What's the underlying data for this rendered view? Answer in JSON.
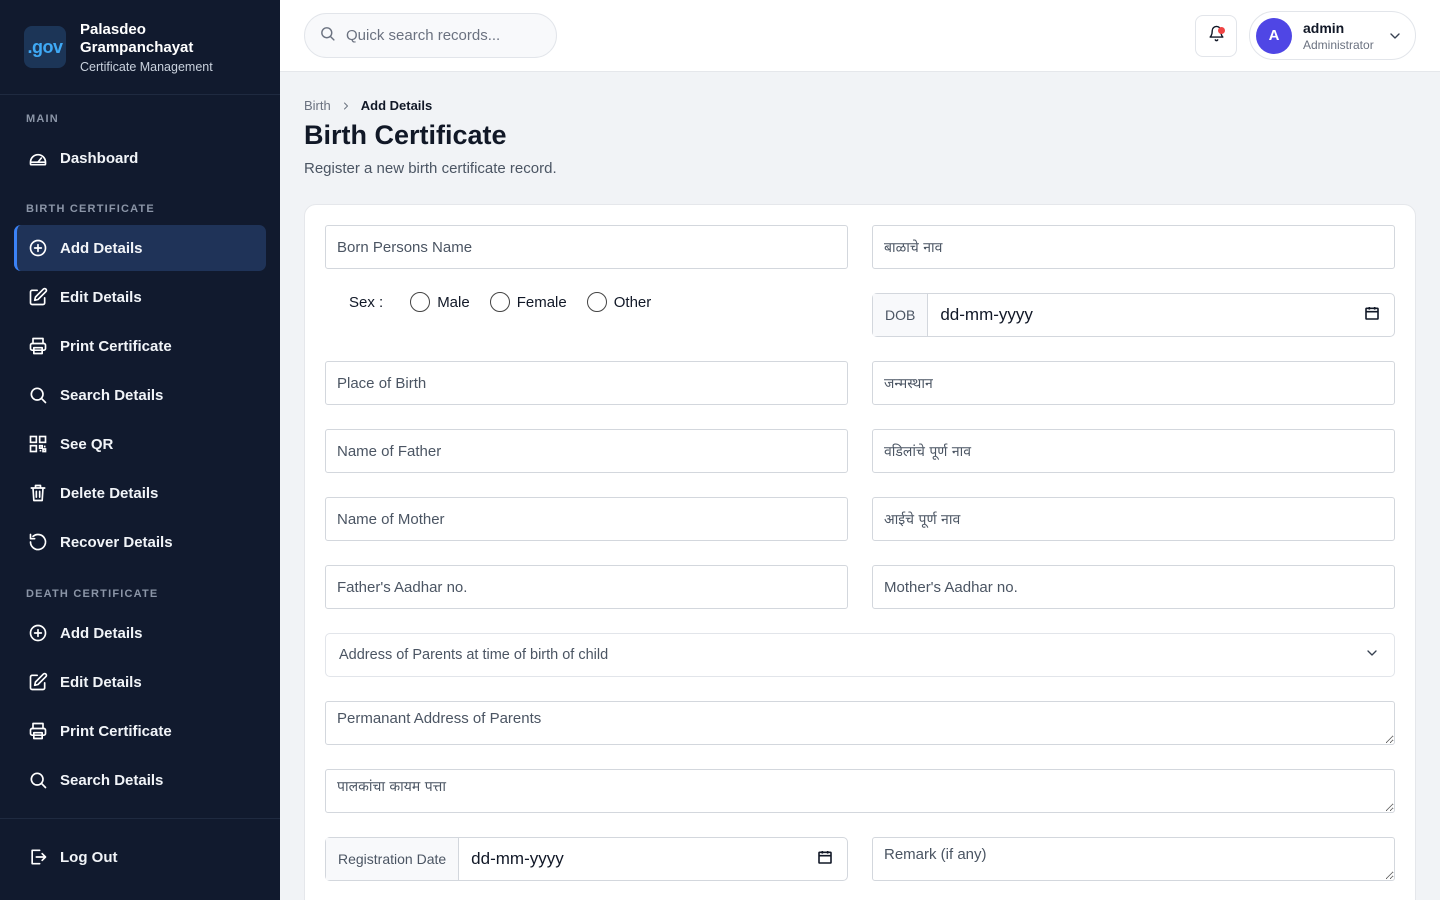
{
  "brand": {
    "logo_text": ".gov",
    "title": "Palasdeo Grampanchayat",
    "subtitle": "Certificate Management"
  },
  "sidebar": {
    "sections": [
      {
        "label": "MAIN"
      },
      {
        "label": "BIRTH CERTIFICATE"
      },
      {
        "label": "DEATH CERTIFICATE"
      }
    ],
    "main_items": [
      {
        "label": "Dashboard",
        "icon": "dashboard-icon"
      }
    ],
    "birth_items": [
      {
        "label": "Add Details",
        "icon": "plus-circle-icon",
        "active": true
      },
      {
        "label": "Edit Details",
        "icon": "edit-icon"
      },
      {
        "label": "Print Certificate",
        "icon": "printer-icon"
      },
      {
        "label": "Search Details",
        "icon": "search-icon"
      },
      {
        "label": "See QR",
        "icon": "qr-code-icon"
      },
      {
        "label": "Delete Details",
        "icon": "trash-icon"
      },
      {
        "label": "Recover Details",
        "icon": "recover-icon"
      }
    ],
    "death_items": [
      {
        "label": "Add Details",
        "icon": "plus-circle-icon"
      },
      {
        "label": "Edit Details",
        "icon": "edit-icon"
      },
      {
        "label": "Print Certificate",
        "icon": "printer-icon"
      },
      {
        "label": "Search Details",
        "icon": "search-icon"
      }
    ],
    "logout": {
      "label": "Log Out",
      "icon": "logout-icon"
    }
  },
  "topbar": {
    "search_placeholder": "Quick search records...",
    "user": {
      "initial": "A",
      "name": "admin",
      "role": "Administrator"
    }
  },
  "breadcrumb": {
    "parent": "Birth",
    "current": "Add Details"
  },
  "page": {
    "title": "Birth Certificate",
    "description": "Register a new birth certificate record."
  },
  "form": {
    "born_name_placeholder": "Born Persons Name",
    "born_name_mr_placeholder": "बाळाचे नाव",
    "sex_label": "Sex :",
    "sex_options": [
      "Male",
      "Female",
      "Other"
    ],
    "dob_label": "DOB",
    "dob_value": "dd-mm-yyyy",
    "place_placeholder": "Place of Birth",
    "place_mr_placeholder": "जन्मस्थान",
    "father_placeholder": "Name of Father",
    "father_mr_placeholder": "वडिलांचे पूर्ण नाव",
    "mother_placeholder": "Name of Mother",
    "mother_mr_placeholder": "आईचे पूर्ण नाव",
    "father_aadhar_placeholder": "Father's Aadhar no.",
    "mother_aadhar_placeholder": "Mother's Aadhar no.",
    "address_select": "Address of Parents at time of birth of child",
    "perm_address_placeholder": "Permanant Address of Parents",
    "perm_address_mr_placeholder": "पालकांचा कायम पत्ता",
    "reg_date_label": "Registration Date",
    "reg_date_value": "dd-mm-yyyy",
    "remark_placeholder": "Remark (if any)"
  },
  "colors": {
    "sidebar_bg": "#111a2e",
    "active_bg": "#1f3358",
    "accent": "#3b82f6",
    "avatar": "#4f46e5",
    "notification": "#ef4444"
  }
}
